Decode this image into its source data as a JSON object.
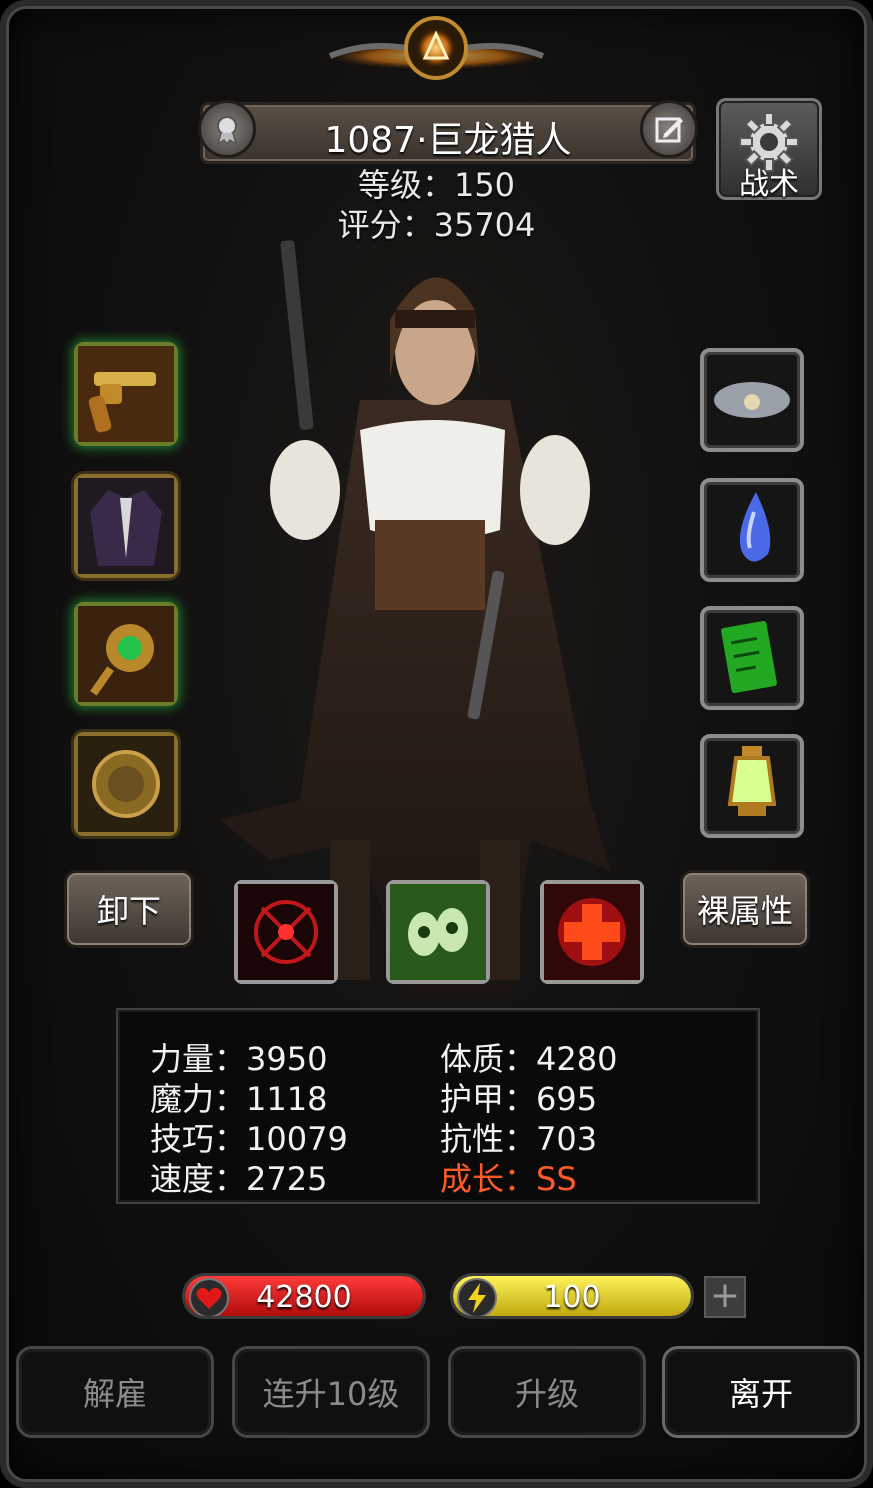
{
  "hero": {
    "name": "1087·巨龙猎人",
    "level_text": "等级：150",
    "score_text": "评分：35704"
  },
  "tactic_button": {
    "label": "战术"
  },
  "equipment_left": [
    {
      "name": "golden-revolver-icon"
    },
    {
      "name": "coat-armor-icon"
    },
    {
      "name": "emerald-brooch-icon"
    },
    {
      "name": "gold-coin-medal-icon"
    }
  ],
  "equipment_right": [
    {
      "name": "cloud-orb-icon"
    },
    {
      "name": "blue-crystal-drop-icon"
    },
    {
      "name": "green-circuit-card-icon"
    },
    {
      "name": "green-lantern-icon"
    }
  ],
  "buttons": {
    "unequip": "卸下",
    "base_attributes": "裸属性"
  },
  "skills": [
    {
      "name": "red-target-skill-icon"
    },
    {
      "name": "green-skulls-skill-icon"
    },
    {
      "name": "red-cross-skill-icon"
    }
  ],
  "stats": {
    "strength": "力量：3950",
    "constitution": "体质：4280",
    "magic": "魔力：1118",
    "armor": "护甲：695",
    "skill": "技巧：10079",
    "resistance": "抗性：703",
    "speed": "速度：2725",
    "growth": "成长：SS"
  },
  "colors": {
    "growth": "#ff5a28",
    "hp_bar": "#d81418",
    "energy_bar": "#e8d020"
  },
  "hp": {
    "value": "42800",
    "icon": "heart-icon"
  },
  "energy": {
    "value": "100",
    "icon": "lightning-icon"
  },
  "plus_label": "+",
  "bottom": {
    "dismiss": "解雇",
    "level10": "连升10级",
    "upgrade": "升级",
    "leave": "离开"
  }
}
